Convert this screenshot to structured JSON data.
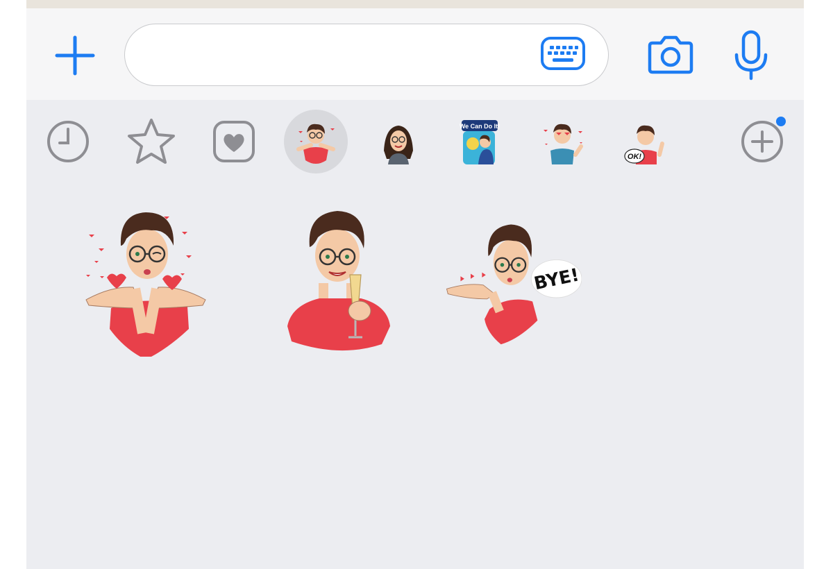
{
  "composer": {
    "placeholder": "",
    "value": "",
    "icons": [
      "plus-icon",
      "keyboard-icon",
      "camera-icon",
      "microphone-icon"
    ]
  },
  "sticker_tray": {
    "items": [
      {
        "name": "recent-stickers",
        "icon": "clock-icon",
        "selected": false
      },
      {
        "name": "favorite-stickers",
        "icon": "star-icon",
        "selected": false
      },
      {
        "name": "emoji-stickers",
        "icon": "heart-icon",
        "selected": false
      },
      {
        "name": "sticker-pack-1",
        "icon": "sticker-thumbnail",
        "selected": true
      },
      {
        "name": "sticker-pack-2",
        "icon": "sticker-thumbnail",
        "selected": false
      },
      {
        "name": "sticker-pack-3",
        "icon": "sticker-thumbnail",
        "selected": false,
        "text": "We Can Do It!"
      },
      {
        "name": "sticker-pack-4",
        "icon": "sticker-thumbnail",
        "selected": false
      },
      {
        "name": "sticker-pack-5",
        "icon": "sticker-thumbnail",
        "selected": false,
        "text": "OK!"
      },
      {
        "name": "add-sticker-pack",
        "icon": "plus-circle-icon",
        "selected": false,
        "badge": true
      }
    ]
  },
  "stickers": [
    {
      "name": "blowing-kisses",
      "text": ""
    },
    {
      "name": "cheers-toast",
      "text": ""
    },
    {
      "name": "bye-kiss",
      "text": "BYE!"
    }
  ],
  "colors": {
    "accent": "#1d7cf2",
    "tray_icon_gray": "#8e8e93",
    "background": "#ecedf1",
    "sticker_red": "#e8404a"
  }
}
